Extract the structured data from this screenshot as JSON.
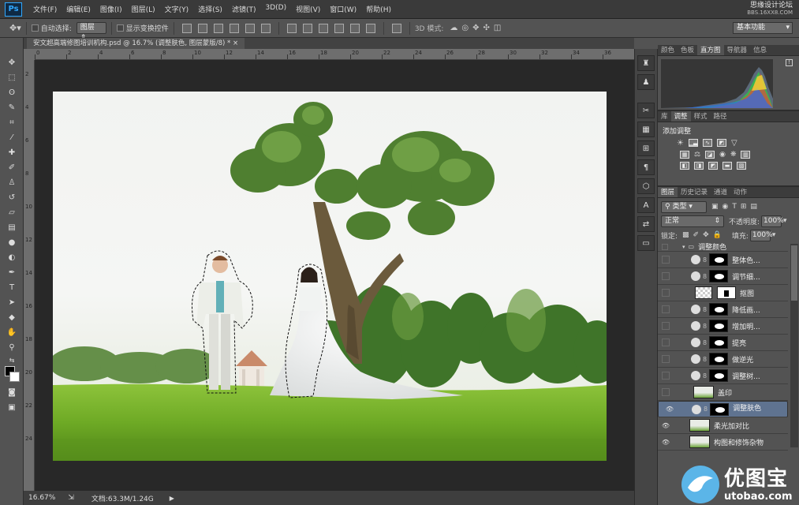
{
  "app": {
    "logo": "Ps"
  },
  "menu": [
    "文件(F)",
    "编辑(E)",
    "图像(I)",
    "图层(L)",
    "文字(Y)",
    "选择(S)",
    "滤镜(T)",
    "3D(D)",
    "视图(V)",
    "窗口(W)",
    "帮助(H)"
  ],
  "watermark_top": {
    "line1": "思缘设计论坛",
    "line2": "BBS.16XX8.COM"
  },
  "options": {
    "auto_select_label": "自动选择:",
    "auto_select_value": "图层",
    "show_transform_label": "显示变换控件",
    "mode_3d_label": "3D 模式:",
    "workspace": "基本功能"
  },
  "document": {
    "tab_title": "安文超高端修图培训机构.psd @ 16.7% (调整肤色, 图层蒙版/8) *"
  },
  "ruler_top_numbers": [
    "0",
    "2",
    "4",
    "6",
    "8",
    "10",
    "12",
    "14",
    "16",
    "18",
    "20",
    "22",
    "24",
    "26",
    "28",
    "30",
    "32",
    "34",
    "36"
  ],
  "ruler_left_numbers": [
    "2",
    "4",
    "6",
    "8",
    "10",
    "12",
    "14",
    "16",
    "18",
    "20",
    "22",
    "24"
  ],
  "status": {
    "zoom": "16.67%",
    "doc": "文档:63.3M/1.24G"
  },
  "panels": {
    "top_tabs": [
      "颜色",
      "色板",
      "直方图",
      "导航器",
      "信息"
    ],
    "top_active": 2,
    "adj_tabs": [
      "库",
      "调整",
      "样式",
      "路径"
    ],
    "adj_active": 1,
    "adj_title": "添加调整",
    "layer_tabs": [
      "图层",
      "历史记录",
      "通道",
      "动作"
    ],
    "layer_active": 0,
    "filter_kind": "类型",
    "blend_mode": "正常",
    "opacity_label": "不透明度:",
    "opacity": "100%",
    "lock_label": "锁定:",
    "fill_label": "填充:",
    "fill": "100%",
    "group_name": "调整颜色"
  },
  "layers": [
    {
      "name": "整体色...",
      "kind": "adj",
      "visible": false,
      "selected": false
    },
    {
      "name": "调节细...",
      "kind": "adj",
      "visible": false,
      "selected": false
    },
    {
      "name": "抠图",
      "kind": "pixelmask",
      "visible": false,
      "selected": false
    },
    {
      "name": "降低画...",
      "kind": "adj",
      "visible": false,
      "selected": false
    },
    {
      "name": "增加明...",
      "kind": "adj",
      "visible": false,
      "selected": false
    },
    {
      "name": "提亮",
      "kind": "adj",
      "visible": false,
      "selected": false
    },
    {
      "name": "做逆光",
      "kind": "adj",
      "visible": false,
      "selected": false
    },
    {
      "name": "调整树...",
      "kind": "adj",
      "visible": false,
      "selected": false
    },
    {
      "name": "盖印",
      "kind": "image",
      "visible": false,
      "selected": false
    },
    {
      "name": "调整肤色",
      "kind": "adj",
      "visible": true,
      "selected": true
    },
    {
      "name": "柔光加对比",
      "kind": "image",
      "visible": true,
      "selected": false
    },
    {
      "name": "构图和修饰杂物",
      "kind": "image",
      "visible": true,
      "selected": false
    }
  ],
  "brand": {
    "name": "优图宝",
    "url": "utobao.com"
  },
  "colors": {
    "selection_blue": "#5f7390",
    "accent": "#31a8ff"
  }
}
